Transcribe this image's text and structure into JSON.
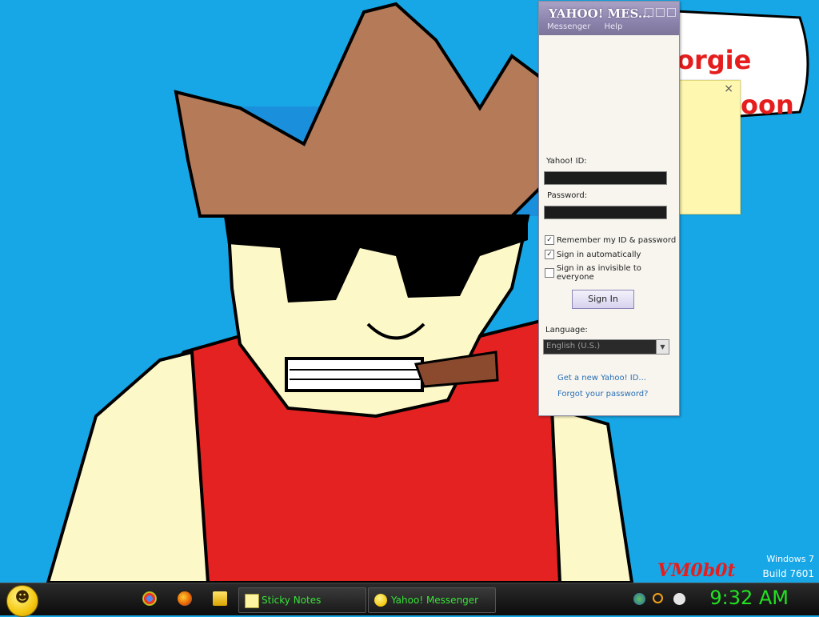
{
  "desktop": {
    "bubble_line1": "orgie",
    "bubble_line2": "oon",
    "os_name": "Windows 7",
    "build": "Build 7601",
    "signature": "VM0b0t"
  },
  "messenger": {
    "title": "YAHOO! MES...",
    "menu": [
      "Messenger",
      "Help"
    ],
    "id_label": "Yahoo! ID:",
    "password_label": "Password:",
    "remember_label": "Remember my ID & password",
    "remember_checked": true,
    "auto_label": "Sign in automatically",
    "auto_checked": true,
    "invisible_label": "Sign in as invisible to everyone",
    "invisible_checked": false,
    "signin_label": "Sign In",
    "language_label": "Language:",
    "language_value": "English (U.S.)",
    "new_id_link": "Get a new Yahoo! ID...",
    "forgot_link": "Forgot your password?"
  },
  "sticky": {
    "close_glyph": "×"
  },
  "taskbar": {
    "sticky_notes_label": "Sticky Notes",
    "messenger_label": "Yahoo! Messenger",
    "clock": "9:32 AM",
    "accent": "#21e221"
  }
}
